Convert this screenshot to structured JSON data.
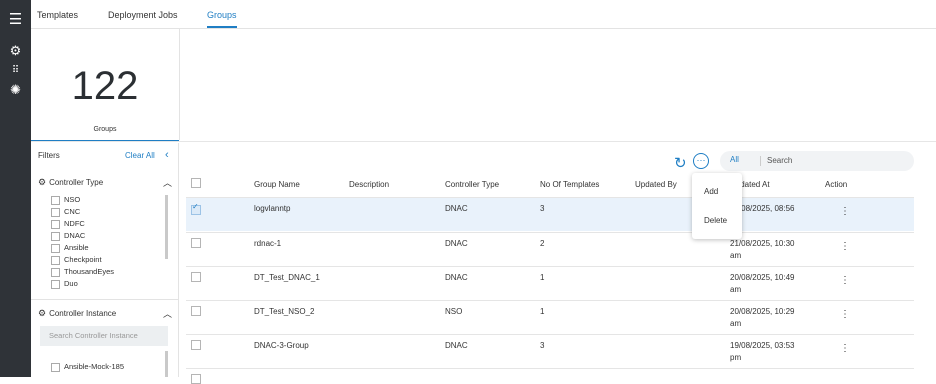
{
  "rail": {
    "icons": [
      "menu-icon",
      "settings-icon",
      "apps-icon",
      "cog-icon"
    ]
  },
  "tabs": [
    {
      "label": "Templates"
    },
    {
      "label": "Deployment Jobs"
    },
    {
      "label": "Groups"
    }
  ],
  "summary": {
    "count": "122",
    "label": "Groups"
  },
  "filters": {
    "title": "Filters",
    "clear_all": "Clear All",
    "controller_type": {
      "title": "Controller Type",
      "options": [
        "NSO",
        "CNC",
        "NDFC",
        "DNAC",
        "Ansible",
        "Checkpoint",
        "ThousandEyes",
        "Duo"
      ]
    },
    "controller_instance": {
      "title": "Controller Instance",
      "search_placeholder": "Search Controller Instance",
      "options": [
        "Ansible-Mock-185"
      ]
    }
  },
  "toolbar": {
    "segment_all": "All",
    "search_placeholder": "Search"
  },
  "table": {
    "columns": [
      "Group Name",
      "Description",
      "Controller Type",
      "No Of Templates",
      "Updated By",
      "Updated At",
      "Action"
    ],
    "rows": [
      {
        "name": "logvlanntp",
        "description": "",
        "type": "DNAC",
        "templates": "3",
        "updated_by": "",
        "updated_at": "21/08/2025, 08:56",
        "updated_at_2": "",
        "selected": true
      },
      {
        "name": "rdnac-1",
        "description": "",
        "type": "DNAC",
        "templates": "2",
        "updated_by": "",
        "updated_at": "21/08/2025, 10:30",
        "updated_at_2": "am",
        "selected": false
      },
      {
        "name": "DT_Test_DNAC_1",
        "description": "",
        "type": "DNAC",
        "templates": "1",
        "updated_by": "",
        "updated_at": "20/08/2025, 10:49",
        "updated_at_2": "am",
        "selected": false
      },
      {
        "name": "DT_Test_NSO_2",
        "description": "",
        "type": "NSO",
        "templates": "1",
        "updated_by": "",
        "updated_at": "20/08/2025, 10:29",
        "updated_at_2": "am",
        "selected": false
      },
      {
        "name": "DNAC-3-Group",
        "description": "",
        "type": "DNAC",
        "templates": "3",
        "updated_by": "",
        "updated_at": "19/08/2025, 03:53",
        "updated_at_2": "pm",
        "selected": false
      }
    ]
  },
  "context_menu": {
    "items": [
      "Add",
      "Delete"
    ]
  },
  "colors": {
    "accent": "#1f7ec4",
    "rail": "#2f3338",
    "selected_row": "#e9f2fb"
  }
}
